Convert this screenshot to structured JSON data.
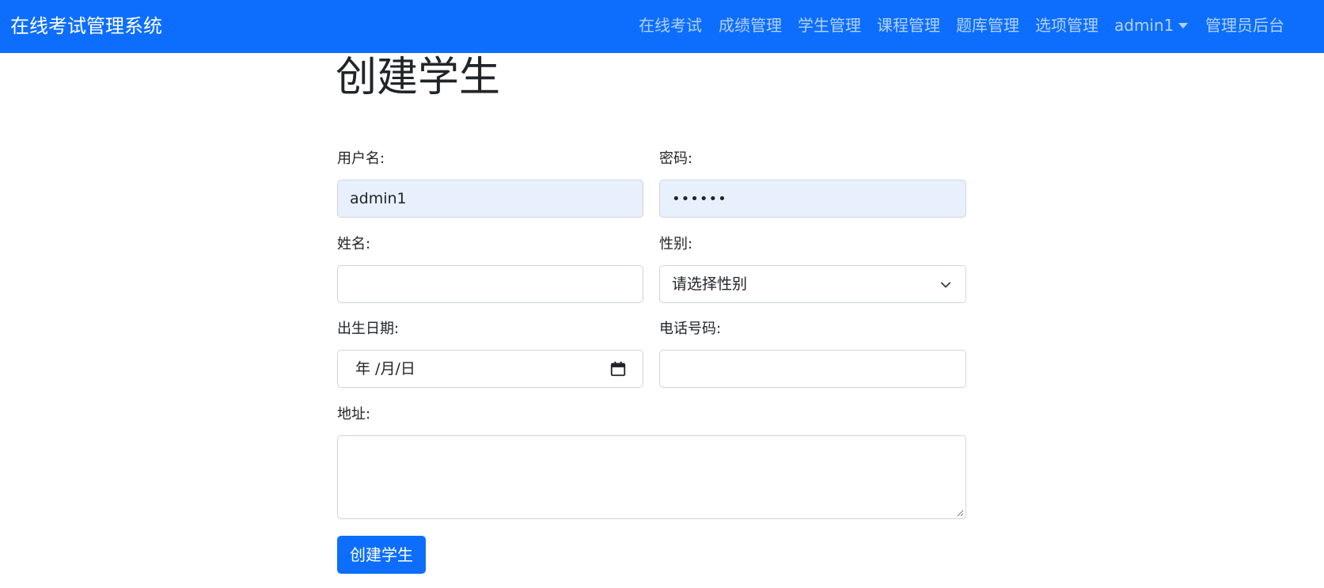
{
  "colors": {
    "navbar_bg": "#0d6efd",
    "brand_text": "#ffffff",
    "nav_link": "rgba(255,255,255,0.68)",
    "autofill_bg": "#e8f0fe",
    "primary_button": "#0d6efd",
    "input_border": "#ced4da"
  },
  "navbar": {
    "brand": "在线考试管理系统",
    "items": [
      {
        "label": "在线考试"
      },
      {
        "label": "成绩管理"
      },
      {
        "label": "学生管理"
      },
      {
        "label": "课程管理"
      },
      {
        "label": "题库管理"
      },
      {
        "label": "选项管理"
      },
      {
        "label": "admin1",
        "icon": "caret-down-icon"
      },
      {
        "label": "管理员后台"
      }
    ]
  },
  "page": {
    "title": "创建学生"
  },
  "form": {
    "username": {
      "label": "用户名:",
      "value": "admin1"
    },
    "password": {
      "label": "密码:",
      "value": "••••••"
    },
    "name": {
      "label": "姓名:",
      "value": ""
    },
    "gender": {
      "label": "性别:",
      "selected": "请选择性别",
      "icon": "chevron-down-icon"
    },
    "birthdate": {
      "label": "出生日期:",
      "value": "年 /月/日",
      "icon": "calendar-icon"
    },
    "phone": {
      "label": "电话号码:",
      "value": ""
    },
    "address": {
      "label": "地址:",
      "value": ""
    },
    "submit_label": "创建学生"
  }
}
